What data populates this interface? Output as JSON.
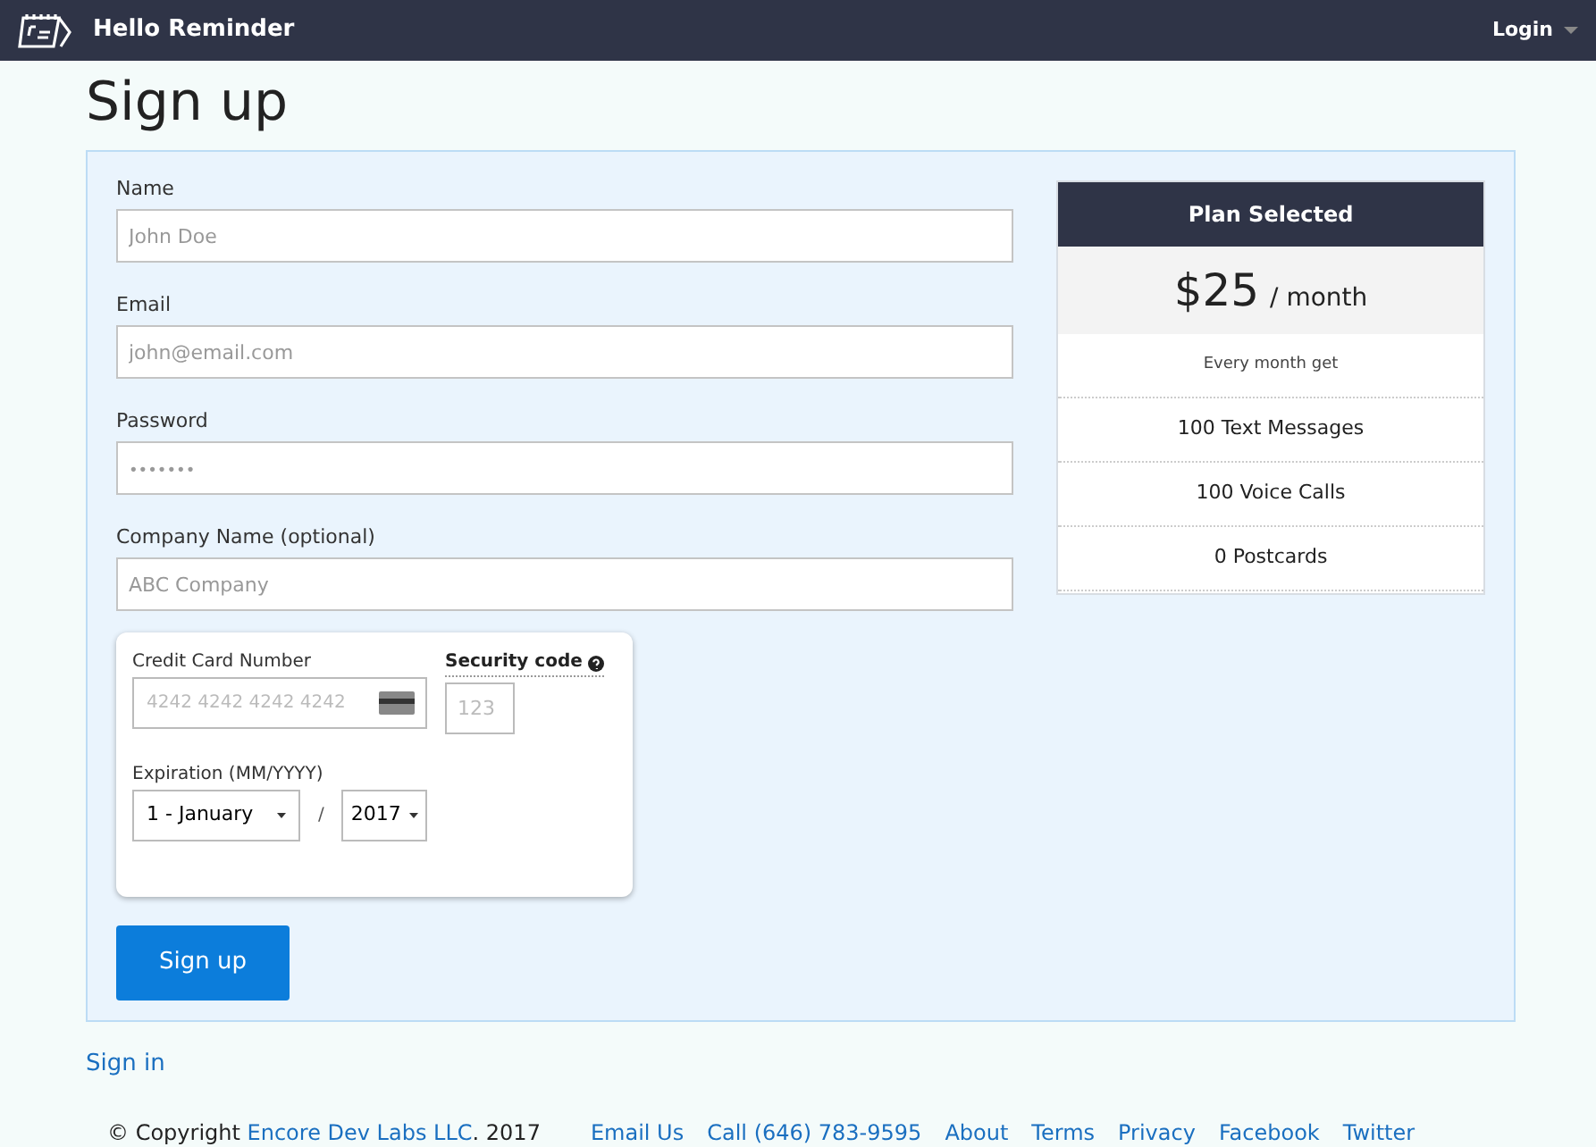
{
  "navbar": {
    "brand": "Hello Reminder",
    "login": "Login"
  },
  "title": "Sign up",
  "fields": [
    {
      "label": "Name",
      "placeholder": "John Doe",
      "kind": "text"
    },
    {
      "label": "Email",
      "placeholder": "john@email.com",
      "kind": "text"
    },
    {
      "label": "Password",
      "placeholder": "•••••••",
      "kind": "password"
    },
    {
      "label": "Company Name (optional)",
      "placeholder": "ABC Company",
      "kind": "text"
    }
  ],
  "card": {
    "number_label": "Credit Card Number",
    "number_placeholder": "4242 4242 4242 4242",
    "security_label": "Security code",
    "security_placeholder": "123",
    "expiration_label": "Expiration (MM/YYYY)",
    "month": "1 - January",
    "separator": "/",
    "year": "2017"
  },
  "submit": "Sign up",
  "plan": {
    "header": "Plan Selected",
    "price": "$25",
    "period": "/ month",
    "subtitle": "Every month get",
    "features": [
      "100 Text Messages",
      "100 Voice Calls",
      "0 Postcards"
    ]
  },
  "sign_in": "Sign in",
  "footer": {
    "prefix": "© Copyright",
    "company": "Encore Dev Labs LLC",
    "suffix": ". 2017",
    "links": [
      "Email Us",
      "Call (646) 783-9595",
      "About",
      "Terms",
      "Privacy",
      "Facebook",
      "Twitter"
    ]
  }
}
